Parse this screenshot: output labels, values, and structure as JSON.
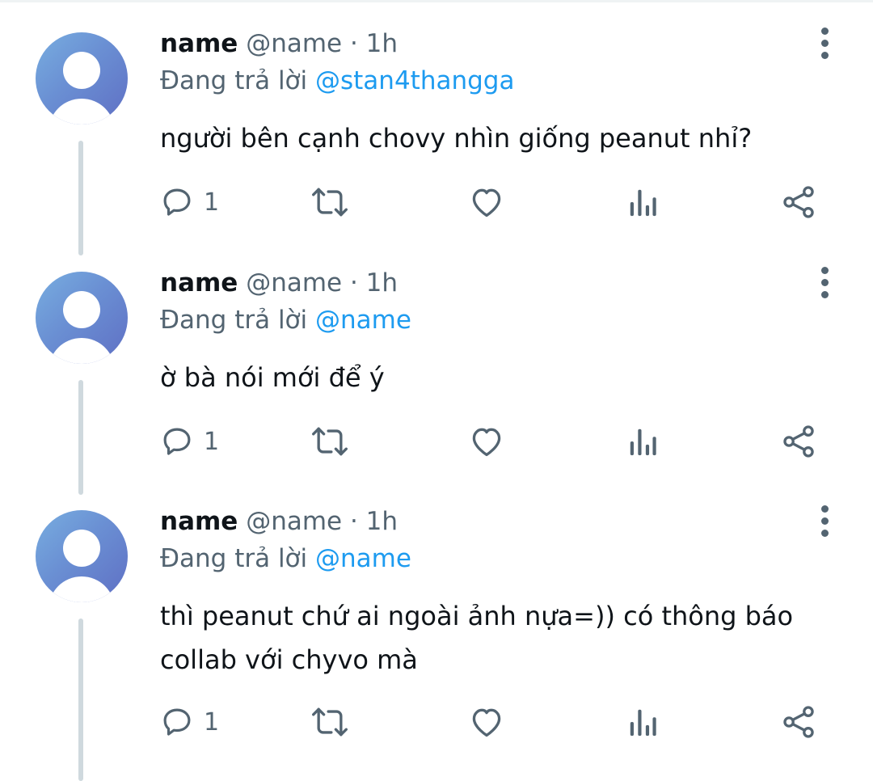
{
  "tweets": [
    {
      "name": "name",
      "handle": "@name",
      "separator": " · ",
      "time": "1h",
      "reply_prefix": "Đang trả lời ",
      "reply_to": "@stan4thangga",
      "text": "người bên cạnh chovy nhìn giống peanut nhỉ?",
      "reply_count": "1"
    },
    {
      "name": "name",
      "handle": "@name",
      "separator": " · ",
      "time": "1h",
      "reply_prefix": "Đang trả lời ",
      "reply_to": "@name",
      "text": "ờ bà nói mới để ý",
      "reply_count": "1"
    },
    {
      "name": "name",
      "handle": "@name",
      "separator": " · ",
      "time": "1h",
      "reply_prefix": "Đang trả lời ",
      "reply_to": "@name",
      "text": "thì peanut chứ ai ngoài ảnh nựa=)) có thông báo collab với chyvo mà",
      "reply_count": "1"
    }
  ],
  "icons": {
    "more": "more-vertical-icon",
    "reply": "reply-bubble-icon",
    "retweet": "retweet-icon",
    "like": "heart-icon",
    "views": "analytics-bars-icon",
    "share": "share-icon"
  },
  "colors": {
    "text": "#0f1419",
    "secondary": "#536471",
    "mention": "#1d9bf0",
    "thread_line": "#cfd9de"
  }
}
